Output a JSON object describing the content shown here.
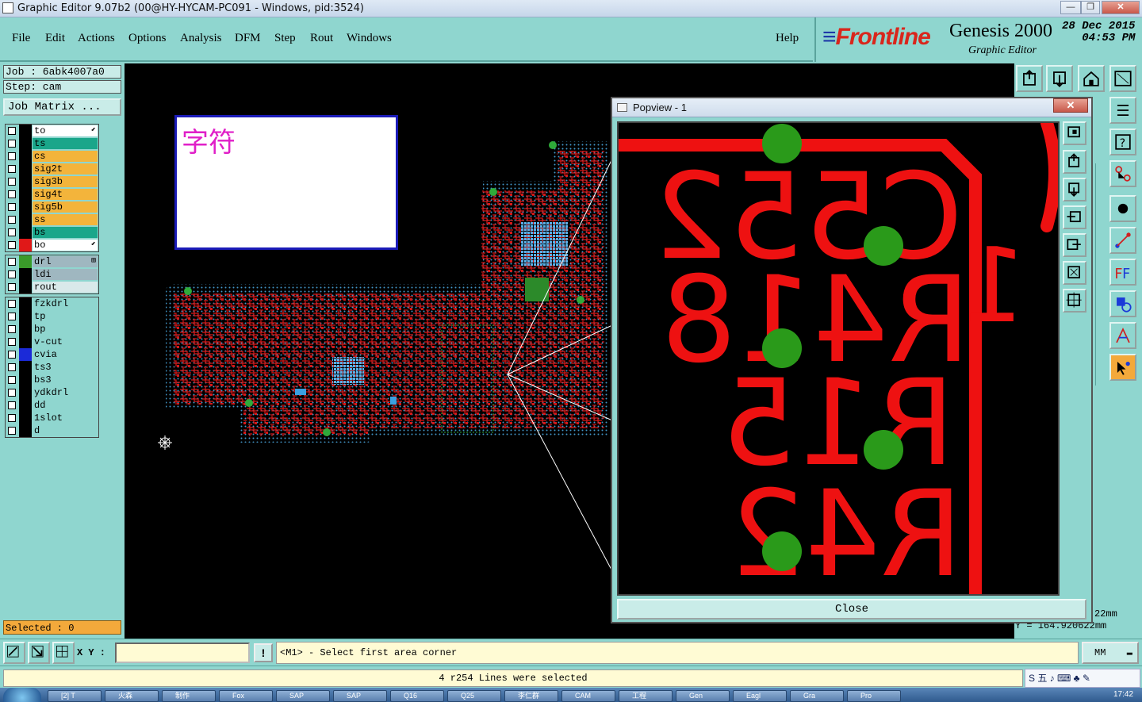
{
  "window": {
    "title": "Graphic Editor 9.07b2 (00@HY-HYCAM-PC091 - Windows, pid:3524)",
    "buttons": {
      "minimize": "—",
      "maximize": "❐",
      "close": "✕"
    }
  },
  "menu": {
    "items": [
      "File",
      "Edit",
      "Actions",
      "Options",
      "Analysis",
      "DFM",
      "Step",
      "Rout",
      "Windows"
    ],
    "help": "Help"
  },
  "brand": {
    "logo": "Frontline",
    "product": "Genesis 2000",
    "subtitle": "Graphic Editor",
    "date": "28 Dec 2015",
    "time": "04:53 PM"
  },
  "job": {
    "job_label": "Job  : 6abk4007a0",
    "step_label": "Step: cam",
    "job_matrix": "Job Matrix ..."
  },
  "layers": {
    "group1": [
      {
        "name": "to",
        "color": "#ffffff",
        "swatch": "#000000",
        "mark": "⬋"
      },
      {
        "name": "ts",
        "color": "#1aa68a",
        "swatch": "#000000",
        "mark": ""
      },
      {
        "name": "cs",
        "color": "#f3b43b",
        "swatch": "#000000",
        "mark": ""
      },
      {
        "name": "sig2t",
        "color": "#f3b43b",
        "swatch": "#000000",
        "mark": ""
      },
      {
        "name": "sig3b",
        "color": "#f3b43b",
        "swatch": "#000000",
        "mark": ""
      },
      {
        "name": "sig4t",
        "color": "#f3b43b",
        "swatch": "#000000",
        "mark": ""
      },
      {
        "name": "sig5b",
        "color": "#f3b43b",
        "swatch": "#000000",
        "mark": ""
      },
      {
        "name": "ss",
        "color": "#f3b43b",
        "swatch": "#000000",
        "mark": ""
      },
      {
        "name": "bs",
        "color": "#1aa68a",
        "swatch": "#000000",
        "mark": ""
      },
      {
        "name": "bo",
        "color": "#ffffff",
        "swatch": "#e01818",
        "mark": "⬋"
      }
    ],
    "group2": [
      {
        "name": "drl",
        "color": "#9fb7c0",
        "swatch": "#3a9a2a",
        "mark": "⊞"
      },
      {
        "name": "ldi",
        "color": "#9fb7c0",
        "swatch": "#000000",
        "mark": ""
      },
      {
        "name": "rout",
        "color": "#d9e9ea",
        "swatch": "#000000",
        "mark": ""
      }
    ],
    "group3": [
      {
        "name": "fzkdrl",
        "color": "#8fd6cf",
        "swatch": "#000000",
        "mark": ""
      },
      {
        "name": "tp",
        "color": "#8fd6cf",
        "swatch": "#000000",
        "mark": ""
      },
      {
        "name": "bp",
        "color": "#8fd6cf",
        "swatch": "#000000",
        "mark": ""
      },
      {
        "name": "v-cut",
        "color": "#8fd6cf",
        "swatch": "#000000",
        "mark": ""
      },
      {
        "name": "cvia",
        "color": "#8fd6cf",
        "swatch": "#1b2ad8",
        "mark": ""
      },
      {
        "name": "ts3",
        "color": "#8fd6cf",
        "swatch": "#000000",
        "mark": ""
      },
      {
        "name": "bs3",
        "color": "#8fd6cf",
        "swatch": "#000000",
        "mark": ""
      },
      {
        "name": "ydkdrl",
        "color": "#8fd6cf",
        "swatch": "#000000",
        "mark": ""
      },
      {
        "name": "dd",
        "color": "#8fd6cf",
        "swatch": "#000000",
        "mark": ""
      },
      {
        "name": "1slot",
        "color": "#8fd6cf",
        "swatch": "#000000",
        "mark": ""
      },
      {
        "name": "d",
        "color": "#8fd6cf",
        "swatch": "#000000",
        "mark": ""
      }
    ]
  },
  "selected": "Selected : 0",
  "canvas": {
    "annotation_text": "字符",
    "coord_x": "22mm",
    "coord_y": "Y = 164.920622mm"
  },
  "popview": {
    "title": "Popview - 1",
    "close_label": "Close",
    "close_x": "✕"
  },
  "command": {
    "xy_label": "X Y :",
    "xy_value": "",
    "warn": "!",
    "prompt": "<M1> - Select first area corner",
    "units": "MM"
  },
  "status": {
    "message": "4 r254 Lines were selected",
    "ime": "S 五 ♪ ⌨ ♣ ✎"
  },
  "taskbar": {
    "items": [
      "[2] T",
      "火森",
      "制作",
      "Fox",
      "SAP",
      "SAP",
      "Q16",
      "Q25",
      "李仁群",
      "CAM",
      "工程",
      "Gen",
      "Eagl",
      "Gra",
      "Pro"
    ],
    "clock": "17:42"
  }
}
